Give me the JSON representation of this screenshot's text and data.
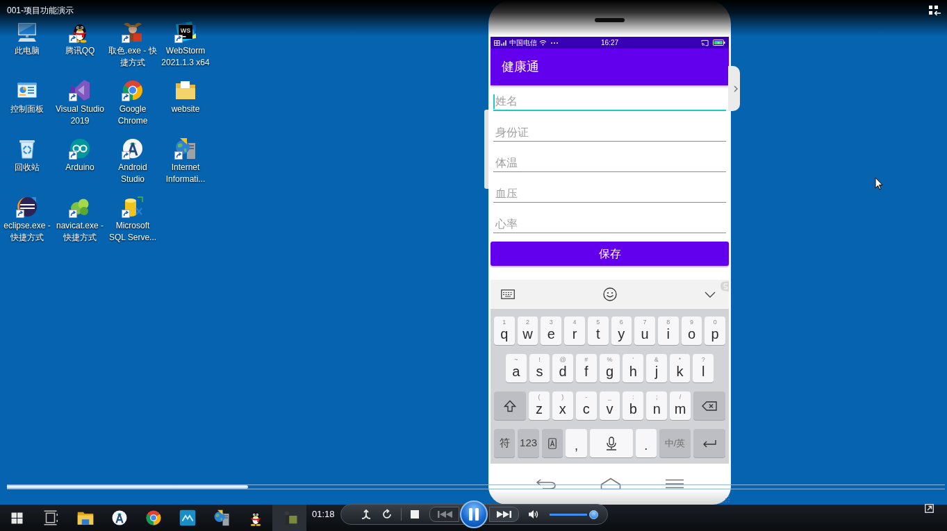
{
  "player": {
    "title": "001-项目功能演示",
    "seek": {
      "level": 0.257
    },
    "time": "01:18",
    "playing": true,
    "previous": {
      "disabled": true
    },
    "next": {
      "disabled": false
    },
    "volume": {
      "level": 0.95
    }
  },
  "desktop": {
    "icons": [
      {
        "label": "此电脑",
        "kind": "computer",
        "shortcut": false
      },
      {
        "label": "腾讯QQ",
        "kind": "qq",
        "shortcut": true
      },
      {
        "label": "取色.exe - 快捷方式",
        "kind": "color_picker",
        "shortcut": true
      },
      {
        "label": "WebStorm 2021.1.3 x64",
        "kind": "webstorm",
        "badge": "WS",
        "shortcut": true
      },
      {
        "label": "控制面板",
        "kind": "control_panel",
        "shortcut": false
      },
      {
        "label": "Visual Studio 2019",
        "kind": "visual_studio",
        "shortcut": true
      },
      {
        "label": "Google Chrome",
        "kind": "chrome",
        "shortcut": true
      },
      {
        "label": "website",
        "kind": "folder",
        "shortcut": false
      },
      {
        "label": "回收站",
        "kind": "recycle_bin",
        "shortcut": false
      },
      {
        "label": "Arduino",
        "kind": "arduino",
        "shortcut": true
      },
      {
        "label": "Android Studio",
        "kind": "android_studio",
        "shortcut": true
      },
      {
        "label": "Internet Informati...",
        "kind": "iis",
        "shortcut": true
      },
      {
        "label": "eclipse.exe - 快捷方式",
        "kind": "eclipse",
        "shortcut": true
      },
      {
        "label": "navicat.exe - 快捷方式",
        "kind": "navicat",
        "shortcut": true
      },
      {
        "label": "Microsoft SQL Serve...",
        "kind": "sql_server",
        "shortcut": true
      }
    ]
  },
  "phone": {
    "status_bar": {
      "carrier": "中国电信",
      "time": "16:27"
    },
    "app_bar": {
      "title": "健康通"
    },
    "fields": [
      {
        "placeholder": "姓名",
        "focused": true
      },
      {
        "placeholder": "身份证",
        "focused": false
      },
      {
        "placeholder": "体温",
        "focused": false
      },
      {
        "placeholder": "血压",
        "focused": false
      },
      {
        "placeholder": "心率",
        "focused": false
      }
    ],
    "save_button": {
      "label": "保存"
    },
    "keyboard": {
      "rows": [
        {
          "keys": [
            {
              "kind": "letter",
              "label": "q",
              "hint": "1"
            },
            {
              "kind": "letter",
              "label": "w",
              "hint": "2"
            },
            {
              "kind": "letter",
              "label": "e",
              "hint": "3"
            },
            {
              "kind": "letter",
              "label": "r",
              "hint": "4"
            },
            {
              "kind": "letter",
              "label": "t",
              "hint": "5"
            },
            {
              "kind": "letter",
              "label": "y",
              "hint": "6"
            },
            {
              "kind": "letter",
              "label": "u",
              "hint": "7"
            },
            {
              "kind": "letter",
              "label": "i",
              "hint": "8"
            },
            {
              "kind": "letter",
              "label": "o",
              "hint": "9"
            },
            {
              "kind": "letter",
              "label": "p",
              "hint": "0"
            }
          ]
        },
        {
          "keys": [
            {
              "kind": "letter",
              "label": "a",
              "hint": "~"
            },
            {
              "kind": "letter",
              "label": "s",
              "hint": "!"
            },
            {
              "kind": "letter",
              "label": "d",
              "hint": "@"
            },
            {
              "kind": "letter",
              "label": "f",
              "hint": "#"
            },
            {
              "kind": "letter",
              "label": "g",
              "hint": "%"
            },
            {
              "kind": "letter",
              "label": "h",
              "hint": "'"
            },
            {
              "kind": "letter",
              "label": "j",
              "hint": "&"
            },
            {
              "kind": "letter",
              "label": "k",
              "hint": "*"
            },
            {
              "kind": "letter",
              "label": "l",
              "hint": "?"
            }
          ]
        },
        {
          "keys": [
            {
              "kind": "shift"
            },
            {
              "kind": "letter",
              "label": "z",
              "hint": "("
            },
            {
              "kind": "letter",
              "label": "x",
              "hint": ")"
            },
            {
              "kind": "letter",
              "label": "c",
              "hint": "-"
            },
            {
              "kind": "letter",
              "label": "v",
              "hint": "_"
            },
            {
              "kind": "letter",
              "label": "b",
              "hint": ":"
            },
            {
              "kind": "letter",
              "label": "n",
              "hint": ";"
            },
            {
              "kind": "letter",
              "label": "m",
              "hint": "/"
            },
            {
              "kind": "delete"
            }
          ]
        },
        {
          "keys": [
            {
              "kind": "function",
              "label": "符"
            },
            {
              "kind": "function",
              "label": "123"
            },
            {
              "kind": "input_mode"
            },
            {
              "kind": "letter",
              "label": ","
            },
            {
              "kind": "voice"
            },
            {
              "kind": "letter",
              "label": "."
            },
            {
              "kind": "language",
              "label": "中/英"
            },
            {
              "kind": "enter"
            }
          ]
        }
      ]
    }
  },
  "taskbar": {
    "apps": [
      {
        "kind": "start",
        "selected": false
      },
      {
        "kind": "task_view",
        "selected": false
      },
      {
        "kind": "explorer",
        "selected": false
      },
      {
        "kind": "android_studio",
        "selected": false
      },
      {
        "kind": "chrome",
        "selected": false
      },
      {
        "kind": "tile_app",
        "selected": false
      },
      {
        "kind": "iis",
        "selected": false
      },
      {
        "kind": "qq",
        "selected": false
      },
      {
        "kind": "recorder",
        "selected": true
      }
    ]
  }
}
